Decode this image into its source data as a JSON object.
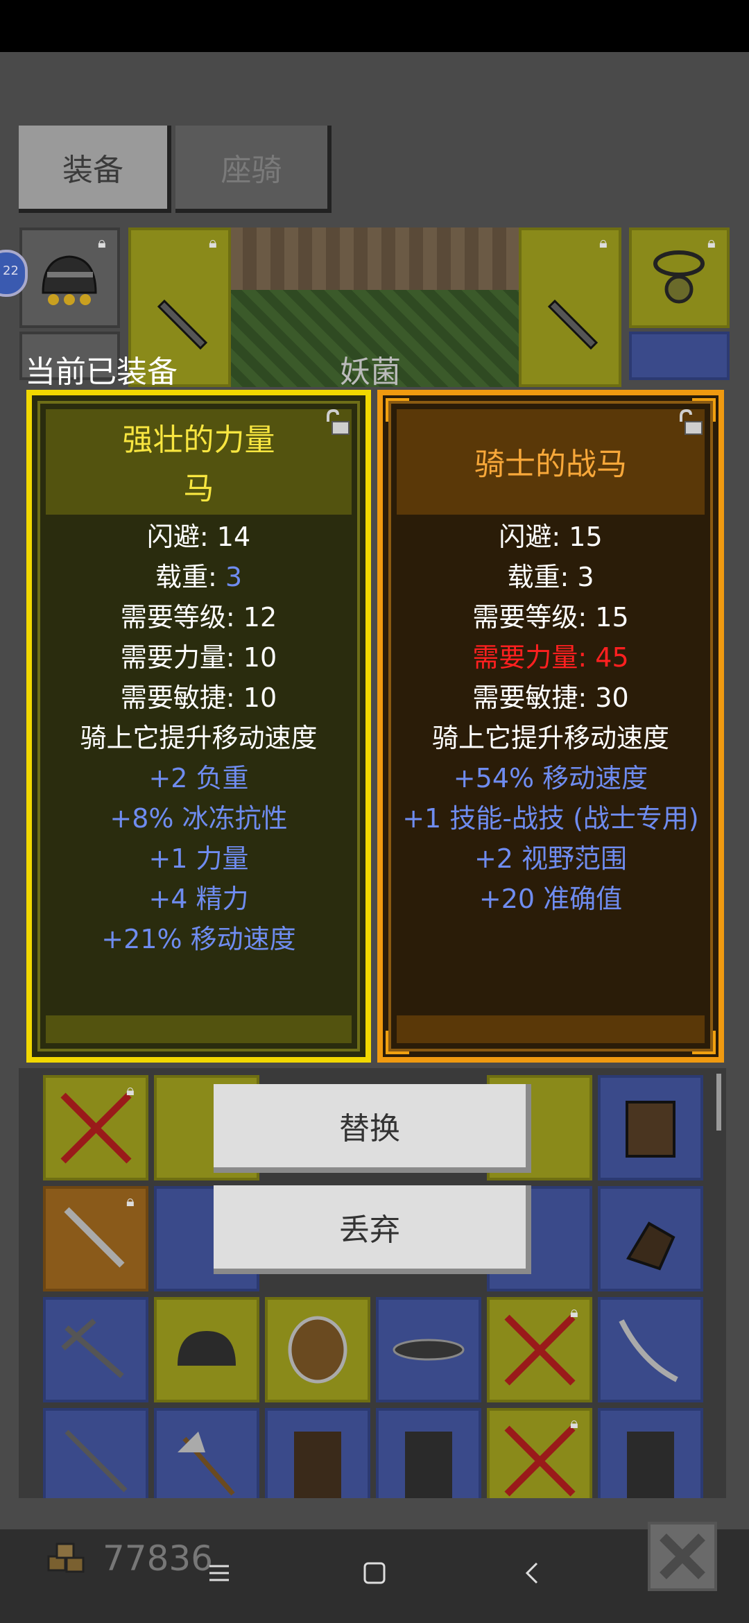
{
  "tabs": {
    "equip": "装备",
    "mount": "座骑"
  },
  "equipped_label": "当前已装备",
  "location_label": "妖菌",
  "level_badge": "22",
  "left_card": {
    "title_line1": "强壮的力量",
    "title_line2": "马",
    "stats": [
      {
        "label": "闪避: ",
        "value": "14",
        "value_color": "white"
      },
      {
        "label": "载重: ",
        "value": "3",
        "value_color": "blue"
      },
      {
        "label": "需要等级: ",
        "value": "12",
        "value_color": "white"
      },
      {
        "label": "需要力量: ",
        "value": "10",
        "value_color": "white"
      },
      {
        "label": "需要敏捷: ",
        "value": "10",
        "value_color": "white"
      }
    ],
    "description": "骑上它提升移动速度",
    "bonuses": [
      "+2 负重",
      "+8% 冰冻抗性",
      "+1 力量",
      "+4 精力",
      "+21% 移动速度"
    ]
  },
  "right_card": {
    "title": "骑士的战马",
    "stats": [
      {
        "label": "闪避: ",
        "value": "15"
      },
      {
        "label": "载重: ",
        "value": "3"
      },
      {
        "label": "需要等级: ",
        "value": "15"
      },
      {
        "label": "需要力量: ",
        "value": "45",
        "unmet": true
      },
      {
        "label": "需要敏捷: ",
        "value": "30"
      }
    ],
    "description": "骑上它提升移动速度",
    "bonuses": [
      "+54% 移动速度",
      "+1 技能-战技 (战士专用)",
      "+2 视野范围",
      "+20 准确值"
    ]
  },
  "buttons": {
    "replace": "替换",
    "drop": "丢弃"
  },
  "gold": "77836",
  "colors": {
    "rarity_yellow": "#f2d800",
    "rarity_orange": "#f09a10",
    "magic_blue": "#6f8cf0",
    "unmet_red": "#ff2020"
  }
}
